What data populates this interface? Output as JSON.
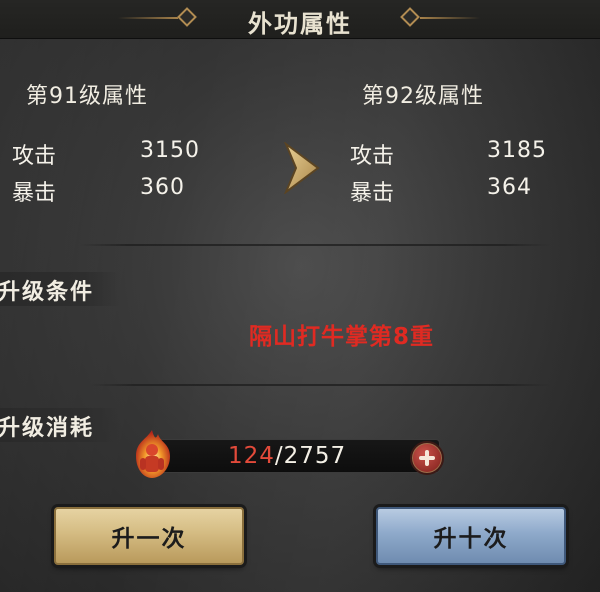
{
  "title": "外功属性",
  "current": {
    "level_title": "第91级属性",
    "stats": [
      {
        "name": "攻击",
        "value": "3150"
      },
      {
        "name": "暴击",
        "value": "360"
      }
    ]
  },
  "next": {
    "level_title": "第92级属性",
    "stats": [
      {
        "name": "攻击",
        "value": "3185"
      },
      {
        "name": "暴击",
        "value": "364"
      }
    ]
  },
  "upgrade_condition": {
    "label": "升级条件",
    "requirement": "隔山打牛掌第8重"
  },
  "upgrade_cost": {
    "label": "升级消耗",
    "have": "124",
    "separator": "/",
    "need": "2757"
  },
  "buttons": {
    "once": "升一次",
    "ten": "升十次"
  },
  "colors": {
    "requirement": "#e02a22",
    "have_insufficient": "#e24a3a",
    "gold_button": "#d4bb82",
    "blue_button": "#8ea9ca"
  },
  "icons": [
    "fire-character-icon",
    "plus-icon",
    "arrow-right-icon"
  ]
}
